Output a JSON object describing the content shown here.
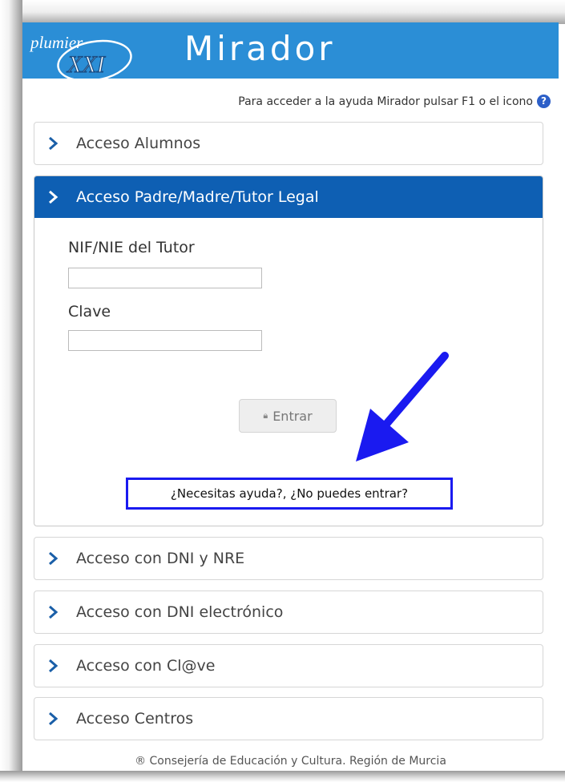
{
  "header": {
    "logo_text_top": "plumier",
    "logo_text_bottom": "XXI",
    "title": "Mirador"
  },
  "help_line": {
    "text": "Para acceder a la ayuda Mirador pulsar F1 o el icono",
    "icon": "question-circle-icon",
    "icon_glyph": "?"
  },
  "sections": {
    "alumnos": "Acceso Alumnos",
    "tutor": "Acceso Padre/Madre/Tutor Legal",
    "dni_nre": "Acceso con DNI y NRE",
    "dni_e": "Acceso con DNI electrónico",
    "clave": "Acceso con Cl@ve",
    "centros": "Acceso Centros"
  },
  "tutor_form": {
    "nif_label": "NIF/NIE del Tutor",
    "nif_value": "",
    "clave_label": "Clave",
    "clave_value": "",
    "enter_button": "Entrar",
    "lock_icon": "lock-icon",
    "help_link": "¿Necesitas ayuda?, ¿No puedes entrar?"
  },
  "footer": {
    "text": "® Consejería de Educación y Cultura. Región de Murcia"
  },
  "colors": {
    "header_bg": "#2b8ed6",
    "active_section_bg": "#0e5fb3",
    "chevron": "#1a5fa8",
    "annotation_blue": "#1a1af0"
  }
}
